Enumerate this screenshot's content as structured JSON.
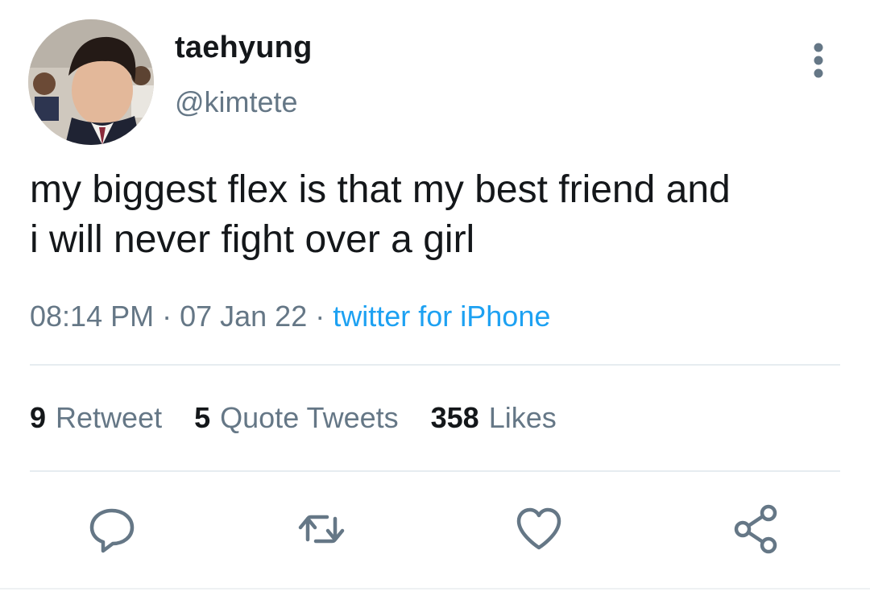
{
  "author": {
    "name": "taehyung",
    "handle": "@kimtete"
  },
  "tweet": {
    "text": "my biggest flex is that my best friend and\ni will never fight over a girl",
    "time": "08:14 PM",
    "date": "07 Jan 22",
    "source": "twitter for iPhone"
  },
  "stats": {
    "retweets_count": "9",
    "retweets_label": "Retweet",
    "quotes_count": "5",
    "quotes_label": "Quote Tweets",
    "likes_count": "358",
    "likes_label": "Likes"
  },
  "icons": {
    "more": "more-vertical-icon",
    "reply": "reply-icon",
    "retweet": "retweet-icon",
    "like": "heart-icon",
    "share": "share-icon"
  },
  "colors": {
    "text": "#14171a",
    "secondary": "#657786",
    "link": "#1da1f2",
    "divider": "#e6ecf0"
  }
}
